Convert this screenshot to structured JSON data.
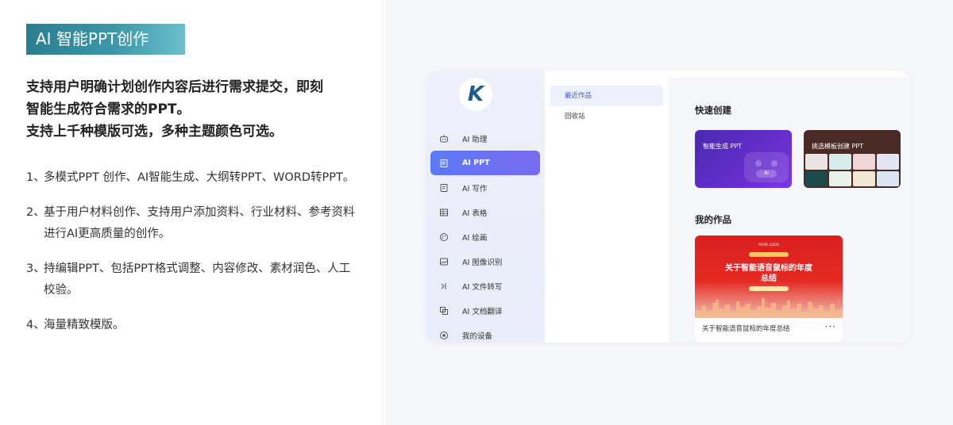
{
  "promo": {
    "title": "AI 智能PPT创作",
    "intro_lines": [
      "支持用户明确计划创作内容后进行需求提交，即刻",
      "智能生成符合需求的PPT。",
      "支持上千种模版可选，多种主题颜色可选。"
    ],
    "features": [
      {
        "num": "1、",
        "text": "多模式PPT 创作、AI智能生成、大纲转PPT、WORD转PPT。"
      },
      {
        "num": "2、",
        "text": "基于用户材料创作、支持用户添加资料、行业材料、参考资料进行AI更高质量的创作。"
      },
      {
        "num": "3、",
        "text": "持编辑PPT、包括PPT格式调整、内容修改、素材润色、人工校验。"
      },
      {
        "num": "4、",
        "text": "海量精致模版。"
      }
    ]
  },
  "app": {
    "logo_text": "K",
    "nav": [
      {
        "label": "AI 助理",
        "icon": "robot-icon"
      },
      {
        "label": "AI PPT",
        "icon": "ppt-icon",
        "active": true
      },
      {
        "label": "AI 写作",
        "icon": "write-icon"
      },
      {
        "label": "AI 表格",
        "icon": "table-icon"
      },
      {
        "label": "AI 绘画",
        "icon": "paint-icon"
      },
      {
        "label": "AI 图像识别",
        "icon": "image-scan-icon"
      },
      {
        "label": "AI 文件转写",
        "icon": "transcribe-icon"
      },
      {
        "label": "AI 文档翻译",
        "icon": "translate-icon"
      },
      {
        "label": "我的设备",
        "icon": "device-icon"
      }
    ],
    "sub_nav": [
      {
        "label": "最近作品",
        "active": true
      },
      {
        "label": "回收站"
      }
    ],
    "quick_create": {
      "title": "快速创建",
      "gen_label": "智能生成 PPT",
      "gen_badge": "AI",
      "tpl_label": "挑选模板创建 PPT"
    },
    "my_works": {
      "title": "我的作品",
      "thumb_logo": "YOUR LOGO",
      "thumb_title_1": "关于智能语音鼠标的年度",
      "thumb_title_2": "总结",
      "item_title": "关于智能语音鼠标的年度总结",
      "more": "···"
    }
  }
}
